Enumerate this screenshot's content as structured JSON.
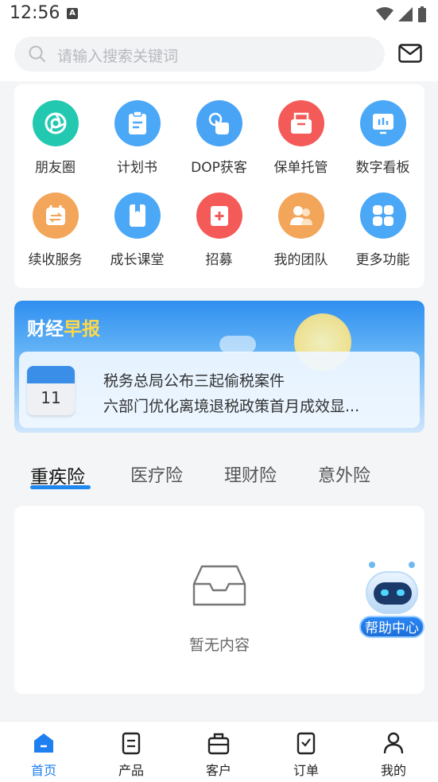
{
  "status_bar": {
    "time": "12:56",
    "notif_letter": "A"
  },
  "header": {
    "search_placeholder": "请输入搜索关键词"
  },
  "grid": [
    {
      "label": "朋友圈",
      "icon": "aperture-icon",
      "color": "#22c9b0"
    },
    {
      "label": "计划书",
      "icon": "clipboard-icon",
      "color": "#4aa8f7"
    },
    {
      "label": "DOP获客",
      "icon": "touch-icon",
      "color": "#49a4f6"
    },
    {
      "label": "保单托管",
      "icon": "folder-icon",
      "color": "#f45a57"
    },
    {
      "label": "数字看板",
      "icon": "dashboard-icon",
      "color": "#4aa8f7"
    },
    {
      "label": "续收服务",
      "icon": "calendar-swap-icon",
      "color": "#f3a55a"
    },
    {
      "label": "成长课堂",
      "icon": "book-icon",
      "color": "#4aa8f7"
    },
    {
      "label": "招募",
      "icon": "medical-plus-icon",
      "color": "#f45a57"
    },
    {
      "label": "我的团队",
      "icon": "team-icon",
      "color": "#f3a55a"
    },
    {
      "label": "更多功能",
      "icon": "grid-icon",
      "color": "#4aa8f7"
    }
  ],
  "news": {
    "title_a": "财经",
    "title_b": "早报",
    "calendar_day": "11",
    "lines": [
      "税务总局公布三起偷税案件",
      "六部门优化离境退税政策首月成效显..."
    ]
  },
  "tabs": [
    "重疾险",
    "医疗险",
    "理财险",
    "意外险"
  ],
  "empty": {
    "text": "暂无内容"
  },
  "help": {
    "label": "帮助中心"
  },
  "bottom_nav": [
    {
      "label": "首页",
      "icon": "home-icon",
      "active": true
    },
    {
      "label": "产品",
      "icon": "document-icon",
      "active": false
    },
    {
      "label": "客户",
      "icon": "briefcase-icon",
      "active": false
    },
    {
      "label": "订单",
      "icon": "order-icon",
      "active": false
    },
    {
      "label": "我的",
      "icon": "profile-icon",
      "active": false
    }
  ],
  "colors": {
    "accent": "#1e88f0",
    "nav_active": "#1e7ff0"
  }
}
